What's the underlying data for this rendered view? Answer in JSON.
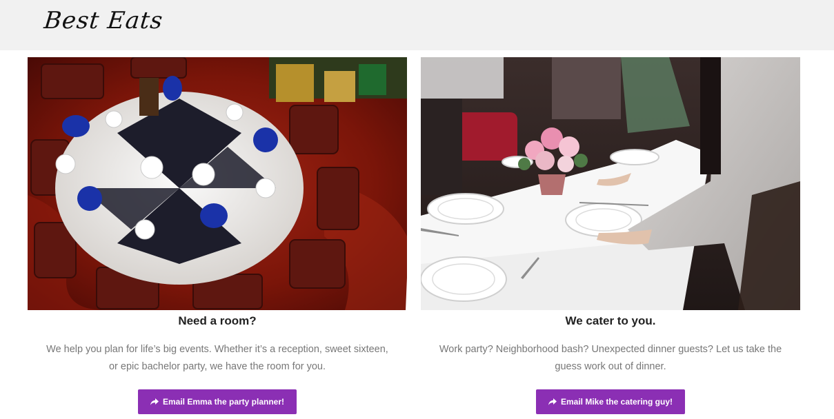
{
  "header": {
    "logo_text": "Best Eats"
  },
  "cards": [
    {
      "title": "Need a room?",
      "text": "We help you plan for life’s big events. Whether it’s a reception, sweet sixteen, or epic bachelor party, we have the room for you.",
      "button_label": "Email Emma the party planner!",
      "button_icon": "share-icon"
    },
    {
      "title": "We cater to you.",
      "text": "Work party?  Neighborhood bash? Unexpected dinner guests? Let us take the guess work out of dinner.",
      "button_label": "Email Mike the catering guy!",
      "button_icon": "share-icon"
    }
  ],
  "colors": {
    "header_bg": "#f1f1f1",
    "button_bg": "#8b2fb4",
    "body_text": "#777777",
    "title_text": "#222222"
  }
}
